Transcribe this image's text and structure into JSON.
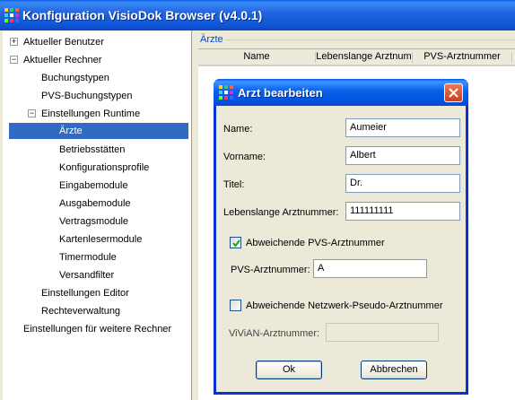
{
  "window": {
    "title": "Konfiguration VisioDok Browser (v4.0.1)"
  },
  "tree": {
    "items": [
      {
        "label": "Aktueller Benutzer",
        "expander": "+"
      },
      {
        "label": "Aktueller Rechner",
        "expander": "−"
      },
      {
        "label": "Buchungstypen"
      },
      {
        "label": "PVS-Buchungstypen"
      },
      {
        "label": "Einstellungen Runtime",
        "expander": "−"
      },
      {
        "label": "Ärzte",
        "selected": true
      },
      {
        "label": "Betriebsstätten"
      },
      {
        "label": "Konfigurationsprofile"
      },
      {
        "label": "Eingabemodule"
      },
      {
        "label": "Ausgabemodule"
      },
      {
        "label": "Vertragsmodule"
      },
      {
        "label": "Kartenlesermodule"
      },
      {
        "label": "Timermodule"
      },
      {
        "label": "Versandfilter"
      },
      {
        "label": "Einstellungen Editor"
      },
      {
        "label": "Rechteverwaltung"
      },
      {
        "label": "Einstellungen für weitere Rechner"
      }
    ]
  },
  "panel": {
    "title": "Ärzte",
    "columns": [
      "Name",
      "Lebenslange Arztnum",
      "PVS-Arztnummer"
    ]
  },
  "dialog": {
    "title": "Arzt bearbeiten",
    "name_label": "Name:",
    "name_value": "Aumeier",
    "vorname_label": "Vorname:",
    "vorname_value": "Albert",
    "titel_label": "Titel:",
    "titel_value": "Dr.",
    "lanr_label": "Lebenslange Arztnummer:",
    "lanr_value": "111111111",
    "pvs_checkbox_label": "Abweichende PVS-Arztnummer",
    "pvs_checked": true,
    "pvs_label": "PVS-Arztnummer:",
    "pvs_value": "A",
    "netz_checkbox_label": "Abweichende Netzwerk-Pseudo-Arztnummer",
    "netz_checked": false,
    "vivian_label": "ViViAN-Arztnummer:",
    "vivian_value": "",
    "ok_label": "Ok",
    "cancel_label": "Abbrechen"
  },
  "colors": {
    "titlebar": "#0a5ee8",
    "selection": "#316ac5",
    "panel_title": "#0046d5"
  }
}
